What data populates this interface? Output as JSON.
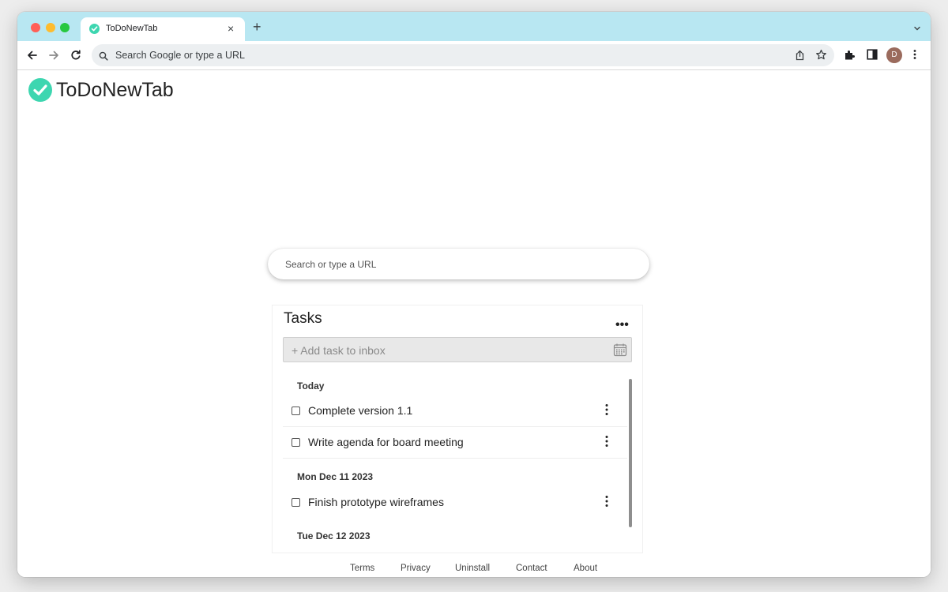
{
  "browser": {
    "tab": {
      "title": "ToDoNewTab"
    },
    "omnibox": {
      "placeholder": "Search Google or type a URL"
    },
    "profile_initial": "D"
  },
  "app": {
    "brand_name": "ToDoNewTab",
    "accent_color": "#3dd6b0",
    "search": {
      "placeholder": "Search or type a URL"
    },
    "tasks": {
      "title": "Tasks",
      "add_task_placeholder": "+ Add task to inbox",
      "groups": [
        {
          "label": "Today",
          "items": [
            {
              "text": "Complete version 1.1",
              "done": false
            },
            {
              "text": "Write agenda for board meeting",
              "done": false
            }
          ]
        },
        {
          "label": "Mon Dec 11 2023",
          "items": [
            {
              "text": "Finish prototype wireframes",
              "done": false
            }
          ]
        },
        {
          "label": "Tue Dec 12 2023",
          "items": []
        }
      ]
    },
    "footer": {
      "links": [
        "Terms",
        "Privacy",
        "Uninstall",
        "Contact",
        "About"
      ]
    }
  }
}
